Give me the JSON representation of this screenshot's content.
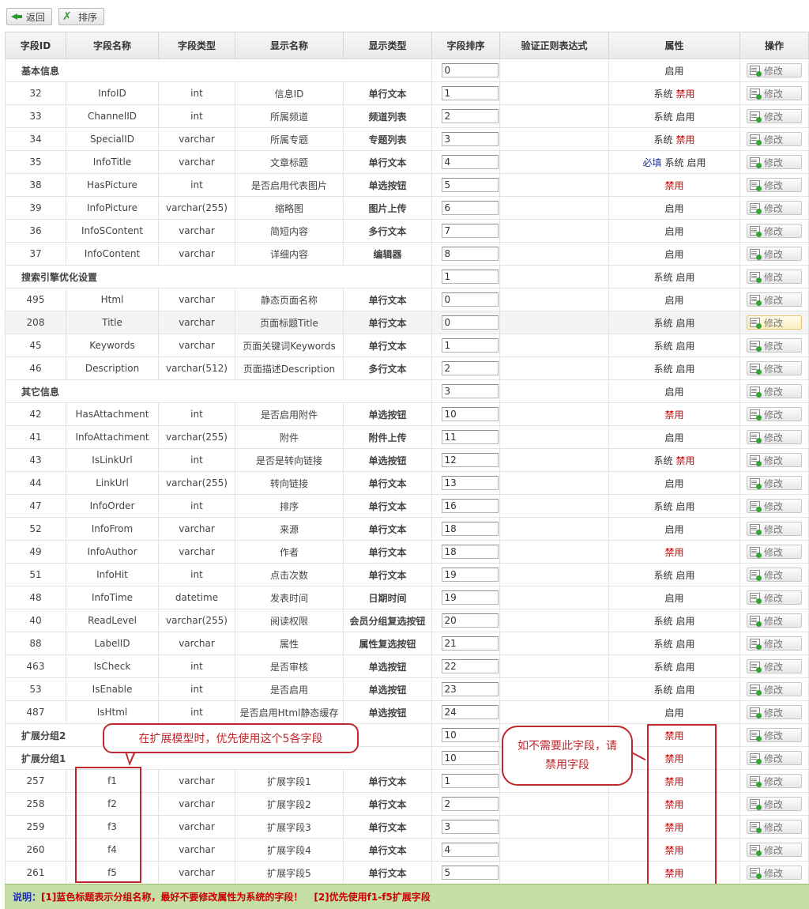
{
  "toolbar": {
    "back_label": "返回",
    "sort_label": "排序"
  },
  "columns": [
    "字段ID",
    "字段名称",
    "字段类型",
    "显示名称",
    "显示类型",
    "字段排序",
    "验证正则表达式",
    "属性",
    "操作"
  ],
  "edit_label": "修改",
  "rows": [
    {
      "group": true,
      "name": "基本信息",
      "order": "0",
      "attrs": [
        {
          "t": "启用",
          "c": "en"
        }
      ]
    },
    {
      "id": "32",
      "field": "InfoID",
      "type": "int",
      "display": "信息ID",
      "dtype": "单行文本",
      "order": "1",
      "attrs": [
        {
          "t": "系统",
          "c": "sys"
        },
        {
          "t": "禁用",
          "c": "dis"
        }
      ]
    },
    {
      "id": "33",
      "field": "ChannelID",
      "type": "int",
      "display": "所属频道",
      "dtype": "频道列表",
      "order": "2",
      "attrs": [
        {
          "t": "系统",
          "c": "sys"
        },
        {
          "t": "启用",
          "c": "en"
        }
      ]
    },
    {
      "id": "34",
      "field": "SpecialID",
      "type": "varchar",
      "display": "所属专题",
      "dtype": "专题列表",
      "order": "3",
      "attrs": [
        {
          "t": "系统",
          "c": "sys"
        },
        {
          "t": "禁用",
          "c": "dis"
        }
      ]
    },
    {
      "id": "35",
      "field": "InfoTitle",
      "type": "varchar",
      "display": "文章标题",
      "dtype": "单行文本",
      "order": "4",
      "attrs": [
        {
          "t": "必填",
          "c": "req"
        },
        {
          "t": "系统",
          "c": "sys"
        },
        {
          "t": "启用",
          "c": "en"
        }
      ]
    },
    {
      "id": "38",
      "field": "HasPicture",
      "type": "int",
      "display": "是否启用代表图片",
      "dtype": "单选按钮",
      "order": "5",
      "attrs": [
        {
          "t": "禁用",
          "c": "dis"
        }
      ]
    },
    {
      "id": "39",
      "field": "InfoPicture",
      "type": "varchar(255)",
      "display": "缩略图",
      "dtype": "图片上传",
      "order": "6",
      "attrs": [
        {
          "t": "启用",
          "c": "en"
        }
      ]
    },
    {
      "id": "36",
      "field": "InfoSContent",
      "type": "varchar",
      "display": "简短内容",
      "dtype": "多行文本",
      "order": "7",
      "attrs": [
        {
          "t": "启用",
          "c": "en"
        }
      ]
    },
    {
      "id": "37",
      "field": "InfoContent",
      "type": "varchar",
      "display": "详细内容",
      "dtype": "编辑器",
      "order": "8",
      "attrs": [
        {
          "t": "启用",
          "c": "en"
        }
      ]
    },
    {
      "group": true,
      "name": "搜索引擎优化设置",
      "order": "1",
      "attrs": [
        {
          "t": "系统",
          "c": "sys"
        },
        {
          "t": "启用",
          "c": "en"
        }
      ]
    },
    {
      "id": "495",
      "field": "Html",
      "type": "varchar",
      "display": "静态页面名称",
      "dtype": "单行文本",
      "order": "0",
      "attrs": [
        {
          "t": "启用",
          "c": "en"
        }
      ]
    },
    {
      "id": "208",
      "field": "Title",
      "type": "varchar",
      "display": "页面标题Title",
      "dtype": "单行文本",
      "order": "0",
      "attrs": [
        {
          "t": "系统",
          "c": "sys"
        },
        {
          "t": "启用",
          "c": "en"
        }
      ],
      "hl": true
    },
    {
      "id": "45",
      "field": "Keywords",
      "type": "varchar",
      "display": "页面关键词Keywords",
      "dtype": "单行文本",
      "order": "1",
      "attrs": [
        {
          "t": "系统",
          "c": "sys"
        },
        {
          "t": "启用",
          "c": "en"
        }
      ]
    },
    {
      "id": "46",
      "field": "Description",
      "type": "varchar(512)",
      "display": "页面描述Description",
      "dtype": "多行文本",
      "order": "2",
      "attrs": [
        {
          "t": "系统",
          "c": "sys"
        },
        {
          "t": "启用",
          "c": "en"
        }
      ]
    },
    {
      "group": true,
      "name": "其它信息",
      "order": "3",
      "attrs": [
        {
          "t": "启用",
          "c": "en"
        }
      ]
    },
    {
      "id": "42",
      "field": "HasAttachment",
      "type": "int",
      "display": "是否启用附件",
      "dtype": "单选按钮",
      "order": "10",
      "attrs": [
        {
          "t": "禁用",
          "c": "dis"
        }
      ]
    },
    {
      "id": "41",
      "field": "InfoAttachment",
      "type": "varchar(255)",
      "display": "附件",
      "dtype": "附件上传",
      "order": "11",
      "attrs": [
        {
          "t": "启用",
          "c": "en"
        }
      ]
    },
    {
      "id": "43",
      "field": "IsLinkUrl",
      "type": "int",
      "display": "是否是转向链接",
      "dtype": "单选按钮",
      "order": "12",
      "attrs": [
        {
          "t": "系统",
          "c": "sys"
        },
        {
          "t": "禁用",
          "c": "dis"
        }
      ]
    },
    {
      "id": "44",
      "field": "LinkUrl",
      "type": "varchar(255)",
      "display": "转向链接",
      "dtype": "单行文本",
      "order": "13",
      "attrs": [
        {
          "t": "启用",
          "c": "en"
        }
      ]
    },
    {
      "id": "47",
      "field": "InfoOrder",
      "type": "int",
      "display": "排序",
      "dtype": "单行文本",
      "order": "16",
      "attrs": [
        {
          "t": "系统",
          "c": "sys"
        },
        {
          "t": "启用",
          "c": "en"
        }
      ]
    },
    {
      "id": "52",
      "field": "InfoFrom",
      "type": "varchar",
      "display": "来源",
      "dtype": "单行文本",
      "order": "18",
      "attrs": [
        {
          "t": "启用",
          "c": "en"
        }
      ]
    },
    {
      "id": "49",
      "field": "InfoAuthor",
      "type": "varchar",
      "display": "作者",
      "dtype": "单行文本",
      "order": "18",
      "attrs": [
        {
          "t": "禁用",
          "c": "dis"
        }
      ]
    },
    {
      "id": "51",
      "field": "InfoHit",
      "type": "int",
      "display": "点击次数",
      "dtype": "单行文本",
      "order": "19",
      "attrs": [
        {
          "t": "系统",
          "c": "sys"
        },
        {
          "t": "启用",
          "c": "en"
        }
      ]
    },
    {
      "id": "48",
      "field": "InfoTime",
      "type": "datetime",
      "display": "发表时间",
      "dtype": "日期时间",
      "order": "19",
      "attrs": [
        {
          "t": "启用",
          "c": "en"
        }
      ]
    },
    {
      "id": "40",
      "field": "ReadLevel",
      "type": "varchar(255)",
      "display": "阅读权限",
      "dtype": "会员分组复选按钮",
      "order": "20",
      "attrs": [
        {
          "t": "系统",
          "c": "sys"
        },
        {
          "t": "启用",
          "c": "en"
        }
      ]
    },
    {
      "id": "88",
      "field": "LabelID",
      "type": "varchar",
      "display": "属性",
      "dtype": "属性复选按钮",
      "order": "21",
      "attrs": [
        {
          "t": "系统",
          "c": "sys"
        },
        {
          "t": "启用",
          "c": "en"
        }
      ]
    },
    {
      "id": "463",
      "field": "IsCheck",
      "type": "int",
      "display": "是否审核",
      "dtype": "单选按钮",
      "order": "22",
      "attrs": [
        {
          "t": "系统",
          "c": "sys"
        },
        {
          "t": "启用",
          "c": "en"
        }
      ]
    },
    {
      "id": "53",
      "field": "IsEnable",
      "type": "int",
      "display": "是否启用",
      "dtype": "单选按钮",
      "order": "23",
      "attrs": [
        {
          "t": "系统",
          "c": "sys"
        },
        {
          "t": "启用",
          "c": "en"
        }
      ]
    },
    {
      "id": "487",
      "field": "IsHtml",
      "type": "int",
      "display": "是否启用Html静态缓存",
      "dtype": "单选按钮",
      "order": "24",
      "attrs": [
        {
          "t": "启用",
          "c": "en"
        }
      ]
    },
    {
      "group": true,
      "name": "扩展分组2",
      "order": "10",
      "attrs": [
        {
          "t": "禁用",
          "c": "dis"
        }
      ]
    },
    {
      "group": true,
      "name": "扩展分组1",
      "order": "10",
      "attrs": [
        {
          "t": "禁用",
          "c": "dis"
        }
      ]
    },
    {
      "id": "257",
      "field": "f1",
      "type": "varchar",
      "display": "扩展字段1",
      "dtype": "单行文本",
      "order": "1",
      "attrs": [
        {
          "t": "禁用",
          "c": "dis"
        }
      ]
    },
    {
      "id": "258",
      "field": "f2",
      "type": "varchar",
      "display": "扩展字段2",
      "dtype": "单行文本",
      "order": "2",
      "attrs": [
        {
          "t": "禁用",
          "c": "dis"
        }
      ]
    },
    {
      "id": "259",
      "field": "f3",
      "type": "varchar",
      "display": "扩展字段3",
      "dtype": "单行文本",
      "order": "3",
      "attrs": [
        {
          "t": "禁用",
          "c": "dis"
        }
      ]
    },
    {
      "id": "260",
      "field": "f4",
      "type": "varchar",
      "display": "扩展字段4",
      "dtype": "单行文本",
      "order": "4",
      "attrs": [
        {
          "t": "禁用",
          "c": "dis"
        }
      ]
    },
    {
      "id": "261",
      "field": "f5",
      "type": "varchar",
      "display": "扩展字段5",
      "dtype": "单行文本",
      "order": "5",
      "attrs": [
        {
          "t": "禁用",
          "c": "dis"
        }
      ]
    }
  ],
  "callouts": {
    "ext_fields": "在扩展模型时，优先使用这个5各字段",
    "disable_hint": "如不需要此字段，请禁用字段"
  },
  "footer": {
    "label": "说明：",
    "note1": "[1]蓝色标题表示分组名称，最好不要修改属性为系统的字段！",
    "note2": "[2]优先使用f1-f5扩展字段"
  }
}
